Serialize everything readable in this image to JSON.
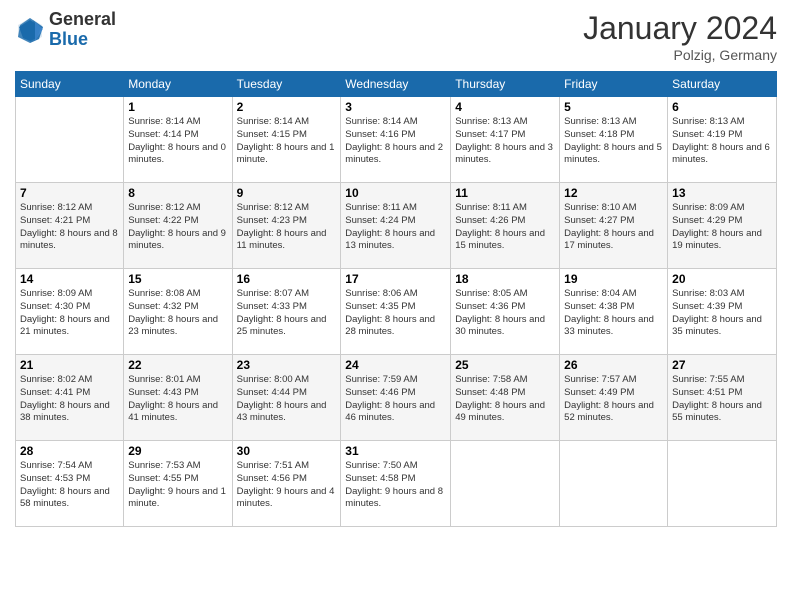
{
  "header": {
    "logo_general": "General",
    "logo_blue": "Blue",
    "month_title": "January 2024",
    "location": "Polzig, Germany"
  },
  "weekdays": [
    "Sunday",
    "Monday",
    "Tuesday",
    "Wednesday",
    "Thursday",
    "Friday",
    "Saturday"
  ],
  "weeks": [
    [
      {
        "day": "",
        "sunrise": "",
        "sunset": "",
        "daylight": ""
      },
      {
        "day": "1",
        "sunrise": "Sunrise: 8:14 AM",
        "sunset": "Sunset: 4:14 PM",
        "daylight": "Daylight: 8 hours and 0 minutes."
      },
      {
        "day": "2",
        "sunrise": "Sunrise: 8:14 AM",
        "sunset": "Sunset: 4:15 PM",
        "daylight": "Daylight: 8 hours and 1 minute."
      },
      {
        "day": "3",
        "sunrise": "Sunrise: 8:14 AM",
        "sunset": "Sunset: 4:16 PM",
        "daylight": "Daylight: 8 hours and 2 minutes."
      },
      {
        "day": "4",
        "sunrise": "Sunrise: 8:13 AM",
        "sunset": "Sunset: 4:17 PM",
        "daylight": "Daylight: 8 hours and 3 minutes."
      },
      {
        "day": "5",
        "sunrise": "Sunrise: 8:13 AM",
        "sunset": "Sunset: 4:18 PM",
        "daylight": "Daylight: 8 hours and 5 minutes."
      },
      {
        "day": "6",
        "sunrise": "Sunrise: 8:13 AM",
        "sunset": "Sunset: 4:19 PM",
        "daylight": "Daylight: 8 hours and 6 minutes."
      }
    ],
    [
      {
        "day": "7",
        "sunrise": "Sunrise: 8:12 AM",
        "sunset": "Sunset: 4:21 PM",
        "daylight": "Daylight: 8 hours and 8 minutes."
      },
      {
        "day": "8",
        "sunrise": "Sunrise: 8:12 AM",
        "sunset": "Sunset: 4:22 PM",
        "daylight": "Daylight: 8 hours and 9 minutes."
      },
      {
        "day": "9",
        "sunrise": "Sunrise: 8:12 AM",
        "sunset": "Sunset: 4:23 PM",
        "daylight": "Daylight: 8 hours and 11 minutes."
      },
      {
        "day": "10",
        "sunrise": "Sunrise: 8:11 AM",
        "sunset": "Sunset: 4:24 PM",
        "daylight": "Daylight: 8 hours and 13 minutes."
      },
      {
        "day": "11",
        "sunrise": "Sunrise: 8:11 AM",
        "sunset": "Sunset: 4:26 PM",
        "daylight": "Daylight: 8 hours and 15 minutes."
      },
      {
        "day": "12",
        "sunrise": "Sunrise: 8:10 AM",
        "sunset": "Sunset: 4:27 PM",
        "daylight": "Daylight: 8 hours and 17 minutes."
      },
      {
        "day": "13",
        "sunrise": "Sunrise: 8:09 AM",
        "sunset": "Sunset: 4:29 PM",
        "daylight": "Daylight: 8 hours and 19 minutes."
      }
    ],
    [
      {
        "day": "14",
        "sunrise": "Sunrise: 8:09 AM",
        "sunset": "Sunset: 4:30 PM",
        "daylight": "Daylight: 8 hours and 21 minutes."
      },
      {
        "day": "15",
        "sunrise": "Sunrise: 8:08 AM",
        "sunset": "Sunset: 4:32 PM",
        "daylight": "Daylight: 8 hours and 23 minutes."
      },
      {
        "day": "16",
        "sunrise": "Sunrise: 8:07 AM",
        "sunset": "Sunset: 4:33 PM",
        "daylight": "Daylight: 8 hours and 25 minutes."
      },
      {
        "day": "17",
        "sunrise": "Sunrise: 8:06 AM",
        "sunset": "Sunset: 4:35 PM",
        "daylight": "Daylight: 8 hours and 28 minutes."
      },
      {
        "day": "18",
        "sunrise": "Sunrise: 8:05 AM",
        "sunset": "Sunset: 4:36 PM",
        "daylight": "Daylight: 8 hours and 30 minutes."
      },
      {
        "day": "19",
        "sunrise": "Sunrise: 8:04 AM",
        "sunset": "Sunset: 4:38 PM",
        "daylight": "Daylight: 8 hours and 33 minutes."
      },
      {
        "day": "20",
        "sunrise": "Sunrise: 8:03 AM",
        "sunset": "Sunset: 4:39 PM",
        "daylight": "Daylight: 8 hours and 35 minutes."
      }
    ],
    [
      {
        "day": "21",
        "sunrise": "Sunrise: 8:02 AM",
        "sunset": "Sunset: 4:41 PM",
        "daylight": "Daylight: 8 hours and 38 minutes."
      },
      {
        "day": "22",
        "sunrise": "Sunrise: 8:01 AM",
        "sunset": "Sunset: 4:43 PM",
        "daylight": "Daylight: 8 hours and 41 minutes."
      },
      {
        "day": "23",
        "sunrise": "Sunrise: 8:00 AM",
        "sunset": "Sunset: 4:44 PM",
        "daylight": "Daylight: 8 hours and 43 minutes."
      },
      {
        "day": "24",
        "sunrise": "Sunrise: 7:59 AM",
        "sunset": "Sunset: 4:46 PM",
        "daylight": "Daylight: 8 hours and 46 minutes."
      },
      {
        "day": "25",
        "sunrise": "Sunrise: 7:58 AM",
        "sunset": "Sunset: 4:48 PM",
        "daylight": "Daylight: 8 hours and 49 minutes."
      },
      {
        "day": "26",
        "sunrise": "Sunrise: 7:57 AM",
        "sunset": "Sunset: 4:49 PM",
        "daylight": "Daylight: 8 hours and 52 minutes."
      },
      {
        "day": "27",
        "sunrise": "Sunrise: 7:55 AM",
        "sunset": "Sunset: 4:51 PM",
        "daylight": "Daylight: 8 hours and 55 minutes."
      }
    ],
    [
      {
        "day": "28",
        "sunrise": "Sunrise: 7:54 AM",
        "sunset": "Sunset: 4:53 PM",
        "daylight": "Daylight: 8 hours and 58 minutes."
      },
      {
        "day": "29",
        "sunrise": "Sunrise: 7:53 AM",
        "sunset": "Sunset: 4:55 PM",
        "daylight": "Daylight: 9 hours and 1 minute."
      },
      {
        "day": "30",
        "sunrise": "Sunrise: 7:51 AM",
        "sunset": "Sunset: 4:56 PM",
        "daylight": "Daylight: 9 hours and 4 minutes."
      },
      {
        "day": "31",
        "sunrise": "Sunrise: 7:50 AM",
        "sunset": "Sunset: 4:58 PM",
        "daylight": "Daylight: 9 hours and 8 minutes."
      },
      {
        "day": "",
        "sunrise": "",
        "sunset": "",
        "daylight": ""
      },
      {
        "day": "",
        "sunrise": "",
        "sunset": "",
        "daylight": ""
      },
      {
        "day": "",
        "sunrise": "",
        "sunset": "",
        "daylight": ""
      }
    ]
  ]
}
